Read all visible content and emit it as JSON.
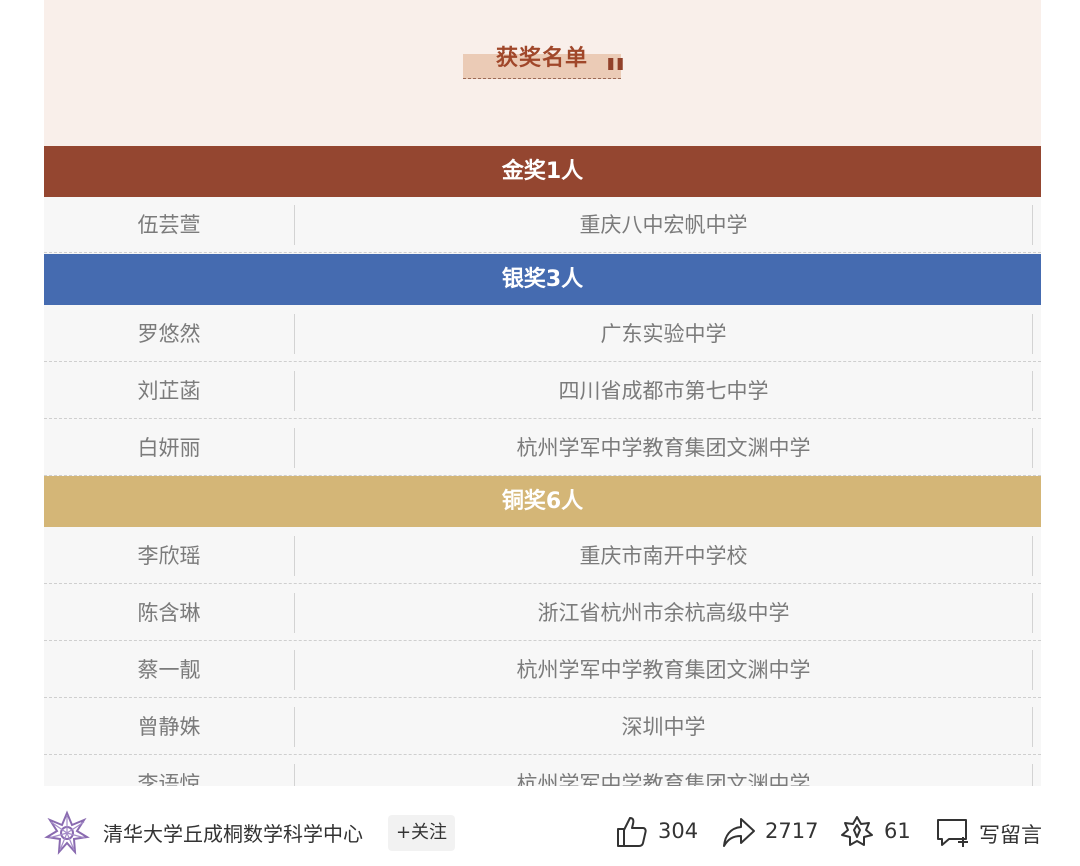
{
  "header": {
    "title": "获奖名单",
    "quote_mark": "\""
  },
  "colors": {
    "gold": "#944630",
    "silver": "#456bb0",
    "bronze": "#d4b677",
    "title_bg": "#f9efea"
  },
  "gold": {
    "title": "金奖1人",
    "rows": [
      {
        "name": "伍芸萱",
        "school": "重庆八中宏帆中学"
      }
    ]
  },
  "silver": {
    "title": "银奖3人",
    "rows": [
      {
        "name": "罗悠然",
        "school": "广东实验中学"
      },
      {
        "name": "刘芷菡",
        "school": "四川省成都市第七中学"
      },
      {
        "name": "白妍丽",
        "school": "杭州学军中学教育集团文渊中学"
      }
    ]
  },
  "bronze": {
    "title": "铜奖6人",
    "rows": [
      {
        "name": "李欣瑶",
        "school": "重庆市南开中学校"
      },
      {
        "name": "陈含琳",
        "school": "浙江省杭州市余杭高级中学"
      },
      {
        "name": "蔡一靓",
        "school": "杭州学军中学教育集团文渊中学"
      },
      {
        "name": "曾静姝",
        "school": "深圳中学"
      },
      {
        "name": "李语惊",
        "school": "杭州学军中学教育集团文渊中学"
      }
    ]
  },
  "footer": {
    "account_name": "清华大学丘成桐数学科学中心",
    "follow_label": "+关注",
    "like_count": "304",
    "share_count": "2717",
    "recommend_count": "61",
    "comment_label": "写留言"
  }
}
